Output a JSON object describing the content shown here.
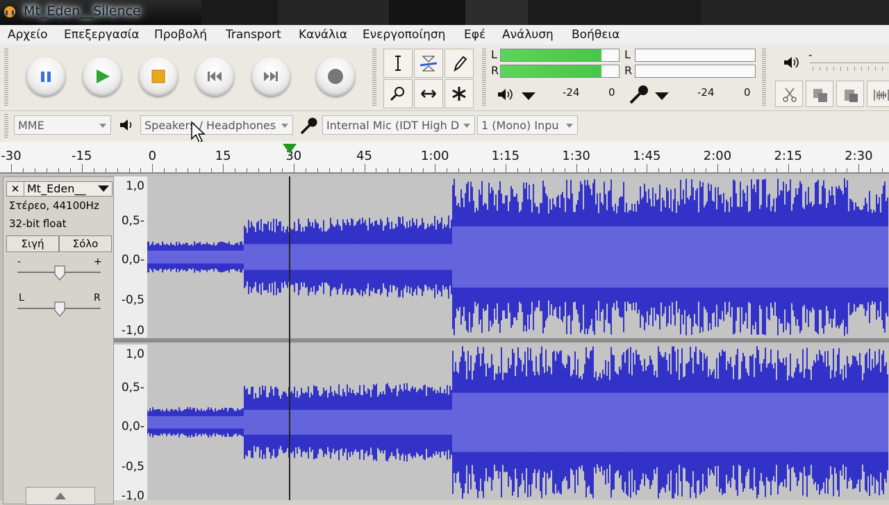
{
  "window": {
    "title": "Mt_Eden__Silence"
  },
  "menu": [
    "Αρχείο",
    "Επεξεργασία",
    "Προβολή",
    "Transport",
    "Κανάλια",
    "Ενεργοποίηση",
    "Εφέ",
    "Ανάλυση",
    "Βοήθεια"
  ],
  "transport": {
    "buttons": [
      "pause-icon",
      "play-icon",
      "stop-icon",
      "skip-start-icon",
      "skip-end-icon",
      "record-icon"
    ]
  },
  "tools": [
    "selection-tool-icon",
    "envelope-tool-icon",
    "draw-tool-icon",
    "zoom-tool-icon",
    "timeshift-tool-icon",
    "multi-tool-icon"
  ],
  "meters": {
    "playback": {
      "l": "L",
      "r": "R",
      "scale_left": "-24",
      "scale_right": "0",
      "level_l": 0.85,
      "level_r": 0.85
    },
    "record": {
      "l": "L",
      "r": "R",
      "scale_left": "-24",
      "scale_right": "0",
      "level_l": 0,
      "level_r": 0
    }
  },
  "mixer": {
    "volume_minus": "-"
  },
  "devices": {
    "host": "MME",
    "output": "Speakers / Headphones",
    "input": "Internal Mic (IDT High D",
    "channels": "1 (Mono) Inpu"
  },
  "timeline": {
    "labels": [
      "-30",
      "-15",
      "0",
      "15",
      "30",
      "45",
      "1:00",
      "1:15",
      "1:30",
      "1:45",
      "2:00",
      "2:15",
      "2:30"
    ]
  },
  "track": {
    "name": "Mt_Eden__",
    "info1": "Στέρεο, 44100Hz",
    "info2": "32-bit float",
    "mute_label": "Σιγή",
    "solo_label": "Σόλο",
    "gain_minus": "-",
    "gain_plus": "+",
    "pan_left": "L",
    "pan_right": "R",
    "close_glyph": "✕"
  },
  "yaxis_labels": [
    "1,0",
    "0,5-",
    "0,0-",
    "-0,5",
    "-1,0"
  ],
  "colors": {
    "waveform": "#3232c8",
    "waveform_rms": "#6464dc",
    "selection_bg": "#c4c4c4",
    "unselected_bg": "#dcdcdc",
    "meter_green": "#49c649",
    "cursor": "#222222"
  }
}
